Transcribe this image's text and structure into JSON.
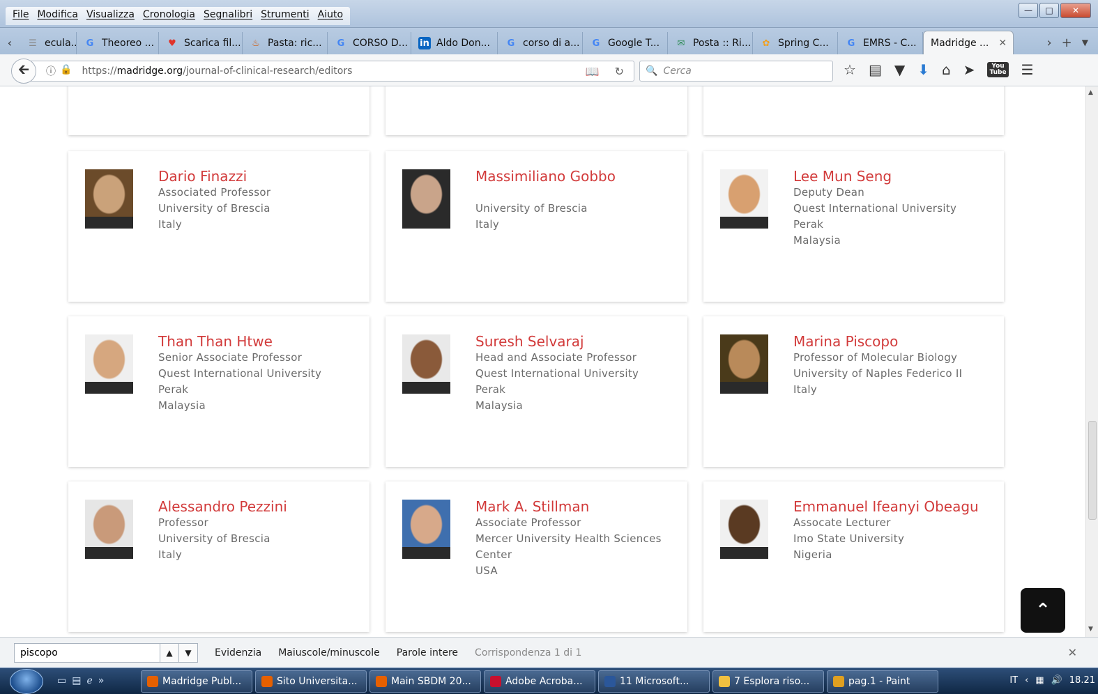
{
  "menu": [
    "File",
    "Modifica",
    "Visualizza",
    "Cronologia",
    "Segnalibri",
    "Strumenti",
    "Aiuto"
  ],
  "tabs": [
    {
      "label": "ecula...",
      "icon": "page-icon",
      "color": "#888888"
    },
    {
      "label": "Theoreo ...",
      "icon": "google-icon",
      "color": "#4285f4"
    },
    {
      "label": "Scarica fil...",
      "icon": "heart-icon",
      "color": "#e0342b"
    },
    {
      "label": "Pasta: ric...",
      "icon": "food-icon",
      "color": "#d35400"
    },
    {
      "label": "CORSO D...",
      "icon": "google-icon",
      "color": "#4285f4"
    },
    {
      "label": "Aldo Don...",
      "icon": "linkedin-icon",
      "color": "#0a66c2"
    },
    {
      "label": "corso di a...",
      "icon": "google-icon",
      "color": "#4285f4"
    },
    {
      "label": "Google T...",
      "icon": "translate-icon",
      "color": "#4285f4"
    },
    {
      "label": "Posta :: Ri...",
      "icon": "mail-icon",
      "color": "#2e8b57"
    },
    {
      "label": "Spring C...",
      "icon": "spring-icon",
      "color": "#f0a020"
    },
    {
      "label": "EMRS - C...",
      "icon": "google-icon",
      "color": "#4285f4"
    },
    {
      "label": "Madridge ...",
      "icon": "none",
      "color": "#ffffff",
      "active": true
    }
  ],
  "url": {
    "domain": "madridge.org",
    "prefix": "https://",
    "path": "/journal-of-clinical-research/editors"
  },
  "search": {
    "placeholder": "Cerca"
  },
  "editors": [
    {
      "name": "Dario Finazzi",
      "lines": [
        "Associated Professor",
        "University of Brescia",
        "Italy"
      ]
    },
    {
      "name": "Massimiliano Gobbo",
      "lines": [
        "",
        "University of Brescia",
        "Italy"
      ]
    },
    {
      "name": "Lee Mun Seng",
      "lines": [
        "Deputy Dean",
        "Quest International University",
        "Perak",
        "Malaysia"
      ]
    },
    {
      "name": "Than Than Htwe",
      "lines": [
        "Senior Associate Professor",
        "Quest International University",
        "Perak",
        "Malaysia"
      ]
    },
    {
      "name": "Suresh Selvaraj",
      "lines": [
        "Head and Associate Professor",
        "Quest International University",
        "Perak",
        "Malaysia"
      ]
    },
    {
      "name": "Marina Piscopo",
      "lines": [
        "Professor of Molecular Biology",
        "University of Naples Federico II",
        "Italy"
      ]
    },
    {
      "name": "Alessandro Pezzini",
      "lines": [
        "Professor",
        "University of Brescia",
        "Italy"
      ]
    },
    {
      "name": "Mark A. Stillman",
      "lines": [
        "Associate Professor",
        "Mercer University Health Sciences",
        "Center",
        "USA"
      ]
    },
    {
      "name": "Emmanuel Ifeanyi Obeagu",
      "lines": [
        "Assocate Lecturer",
        "Imo State University",
        "Nigeria"
      ]
    }
  ],
  "findbar": {
    "value": "piscopo",
    "highlight": "Evidenzia",
    "match_case": "Maiuscole/minuscole",
    "whole_words": "Parole intere",
    "status": "Corrispondenza 1 di 1"
  },
  "taskbar": {
    "items": [
      {
        "label": "Madridge Publ...",
        "color": "#e66000"
      },
      {
        "label": "Sito Universita...",
        "color": "#e66000"
      },
      {
        "label": "Main SBDM 20...",
        "color": "#e66000"
      },
      {
        "label": "Adobe Acroba...",
        "color": "#c8102e"
      },
      {
        "label": "11 Microsoft...",
        "color": "#2b579a"
      },
      {
        "label": "7 Esplora riso...",
        "color": "#f0c040"
      },
      {
        "label": "pag.1 - Paint",
        "color": "#e0a020"
      }
    ],
    "lang": "IT",
    "time": "18.21"
  }
}
